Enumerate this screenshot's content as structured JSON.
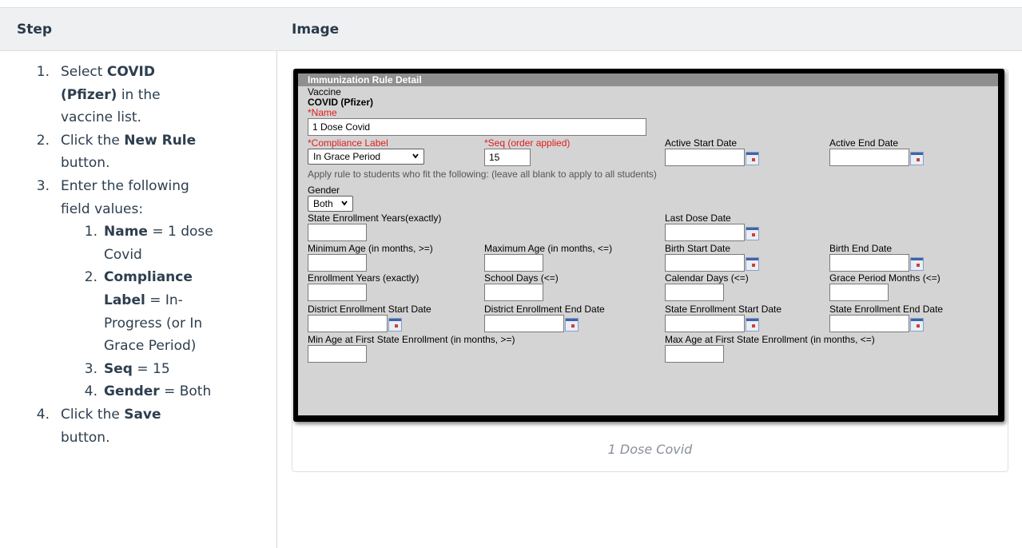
{
  "table": {
    "header_step": "Step",
    "header_image": "Image"
  },
  "steps": [
    {
      "num": "1.",
      "segments": [
        {
          "t": "Select "
        },
        {
          "t": "COVID",
          "b": true
        }
      ],
      "lines": 1
    },
    {
      "num": "",
      "segments": [
        {
          "t": "(Pfizer)",
          "b": true
        },
        {
          "t": " in the"
        }
      ]
    },
    {
      "num": "",
      "segments": [
        {
          "t": "vaccine list."
        }
      ]
    },
    {
      "num": "2.",
      "segments": [
        {
          "t": "Click the "
        },
        {
          "t": "New Rule",
          "b": true
        }
      ]
    },
    {
      "num": "",
      "segments": [
        {
          "t": "button."
        }
      ]
    },
    {
      "num": "3.",
      "segments": [
        {
          "t": "Enter the following"
        }
      ]
    },
    {
      "num": "",
      "segments": [
        {
          "t": "field values:"
        }
      ]
    },
    {
      "num": "1.",
      "indent": true,
      "segments": [
        {
          "t": "Name",
          "b": true
        },
        {
          "t": " = 1 dose"
        }
      ]
    },
    {
      "num": "",
      "indent": true,
      "segments": [
        {
          "t": "Covid"
        }
      ]
    },
    {
      "num": "2.",
      "indent": true,
      "segments": [
        {
          "t": "Compliance",
          "b": true
        }
      ]
    },
    {
      "num": "",
      "indent": true,
      "segments": [
        {
          "t": "Label",
          "b": true
        },
        {
          "t": " = In-"
        }
      ]
    },
    {
      "num": "",
      "indent": true,
      "segments": [
        {
          "t": "Progress (or In"
        }
      ]
    },
    {
      "num": "",
      "indent": true,
      "segments": [
        {
          "t": "Grace Period)"
        }
      ]
    },
    {
      "num": "3.",
      "indent": true,
      "segments": [
        {
          "t": "Seq",
          "b": true
        },
        {
          "t": " = 15"
        }
      ]
    },
    {
      "num": "4.",
      "indent": true,
      "segments": [
        {
          "t": "Gender",
          "b": true
        },
        {
          "t": " = Both"
        }
      ]
    },
    {
      "num": "4.",
      "segments": [
        {
          "t": "Click the "
        },
        {
          "t": "Save",
          "b": true
        }
      ]
    },
    {
      "num": "",
      "segments": [
        {
          "t": "button."
        }
      ]
    }
  ],
  "screenshot": {
    "panel_title": "Immunization Rule Detail",
    "vaccine_label": "Vaccine",
    "vaccine_value": "COVID (Pfizer)",
    "name_label": "*Name",
    "name_value": "1 Dose Covid",
    "compliance_label": "*Compliance Label",
    "compliance_value": "In Grace Period",
    "seq_label": "*Seq (order applied)",
    "seq_value": "15",
    "active_start_label": "Active Start Date",
    "active_end_label": "Active End Date",
    "apply_note": "Apply rule to students who fit the following: (leave all blank to apply to all students)",
    "gender_label": "Gender",
    "gender_value": "Both",
    "state_enroll_years_label": "State Enrollment Years(exactly)",
    "last_dose_label": "Last Dose Date",
    "min_age_label": "Minimum Age (in months, >=)",
    "max_age_label": "Maximum Age (in months, <=)",
    "birth_start_label": "Birth Start Date",
    "birth_end_label": "Birth End Date",
    "enroll_years_label": "Enrollment Years (exactly)",
    "school_days_label": "School Days (<=)",
    "calendar_days_label": "Calendar Days (<=)",
    "grace_months_label": "Grace Period Months (<=)",
    "district_start_label": "District Enrollment Start Date",
    "district_end_label": "District Enrollment End Date",
    "state_start_label": "State Enrollment Start Date",
    "state_end_label": "State Enrollment End Date",
    "min_age_first_label": "Min Age at First State Enrollment (in months, >=)",
    "max_age_first_label": "Max Age at First State Enrollment (in months, <=)"
  },
  "caption": "1 Dose Covid"
}
